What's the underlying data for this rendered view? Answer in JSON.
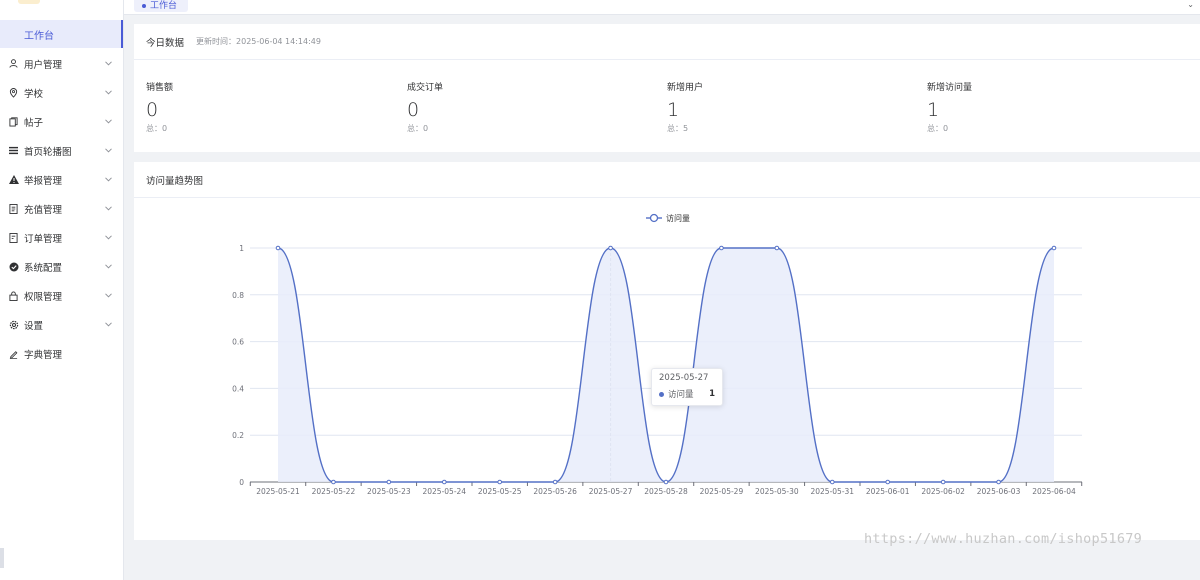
{
  "sidebar": {
    "active_item": "工作台",
    "items": [
      {
        "label": "用户管理",
        "icon": "user-icon",
        "expandable": true
      },
      {
        "label": "学校",
        "icon": "location-icon",
        "expandable": true
      },
      {
        "label": "帖子",
        "icon": "copy-icon",
        "expandable": true
      },
      {
        "label": "首页轮播图",
        "icon": "list-icon",
        "expandable": true
      },
      {
        "label": "举报管理",
        "icon": "warning-icon",
        "expandable": true
      },
      {
        "label": "充值管理",
        "icon": "document-icon",
        "expandable": true
      },
      {
        "label": "订单管理",
        "icon": "tickets-icon",
        "expandable": true
      },
      {
        "label": "系统配置",
        "icon": "check-circle-icon",
        "expandable": true
      },
      {
        "label": "权限管理",
        "icon": "lock-icon",
        "expandable": true
      },
      {
        "label": "设置",
        "icon": "setting-icon",
        "expandable": true
      },
      {
        "label": "字典管理",
        "icon": "edit-icon",
        "expandable": false
      }
    ]
  },
  "tabs": {
    "active_label": "工作台"
  },
  "today": {
    "title": "今日数据",
    "update_time": "更新时间：2025-06-04 14:14:49",
    "stats": [
      {
        "label": "销售额",
        "value": "0",
        "total": "总：0"
      },
      {
        "label": "成交订单",
        "value": "0",
        "total": "总：0"
      },
      {
        "label": "新增用户",
        "value": "1",
        "total": "总：5"
      },
      {
        "label": "新增访问量",
        "value": "1",
        "total": "总：0"
      }
    ]
  },
  "trend": {
    "title": "访问量趋势图"
  },
  "tooltip": {
    "date": "2025-05-27",
    "series": "访问量",
    "value": "1"
  },
  "watermark": "https://www.huzhan.com/ishop51679",
  "colors": {
    "accent": "#4a5bd6",
    "series": "#5470c6",
    "area": "#e8ecfa"
  },
  "chart_data": {
    "type": "area",
    "title": "",
    "legend": [
      "访问量"
    ],
    "legend_position": "top-center",
    "x": [
      "2025-05-21",
      "2025-05-22",
      "2025-05-23",
      "2025-05-24",
      "2025-05-25",
      "2025-05-26",
      "2025-05-27",
      "2025-05-28",
      "2025-05-29",
      "2025-05-30",
      "2025-05-31",
      "2025-06-01",
      "2025-06-02",
      "2025-06-03",
      "2025-06-04"
    ],
    "series": [
      {
        "name": "访问量",
        "values": [
          1,
          0,
          0,
          0,
          0,
          0,
          1,
          0,
          1,
          1,
          0,
          0,
          0,
          0,
          1
        ]
      }
    ],
    "yticks": [
      "0",
      "0.2",
      "0.4",
      "0.6",
      "0.8",
      "1"
    ],
    "ylim": [
      0,
      1
    ],
    "smooth": true,
    "grid": true,
    "highlight_index": 6
  }
}
